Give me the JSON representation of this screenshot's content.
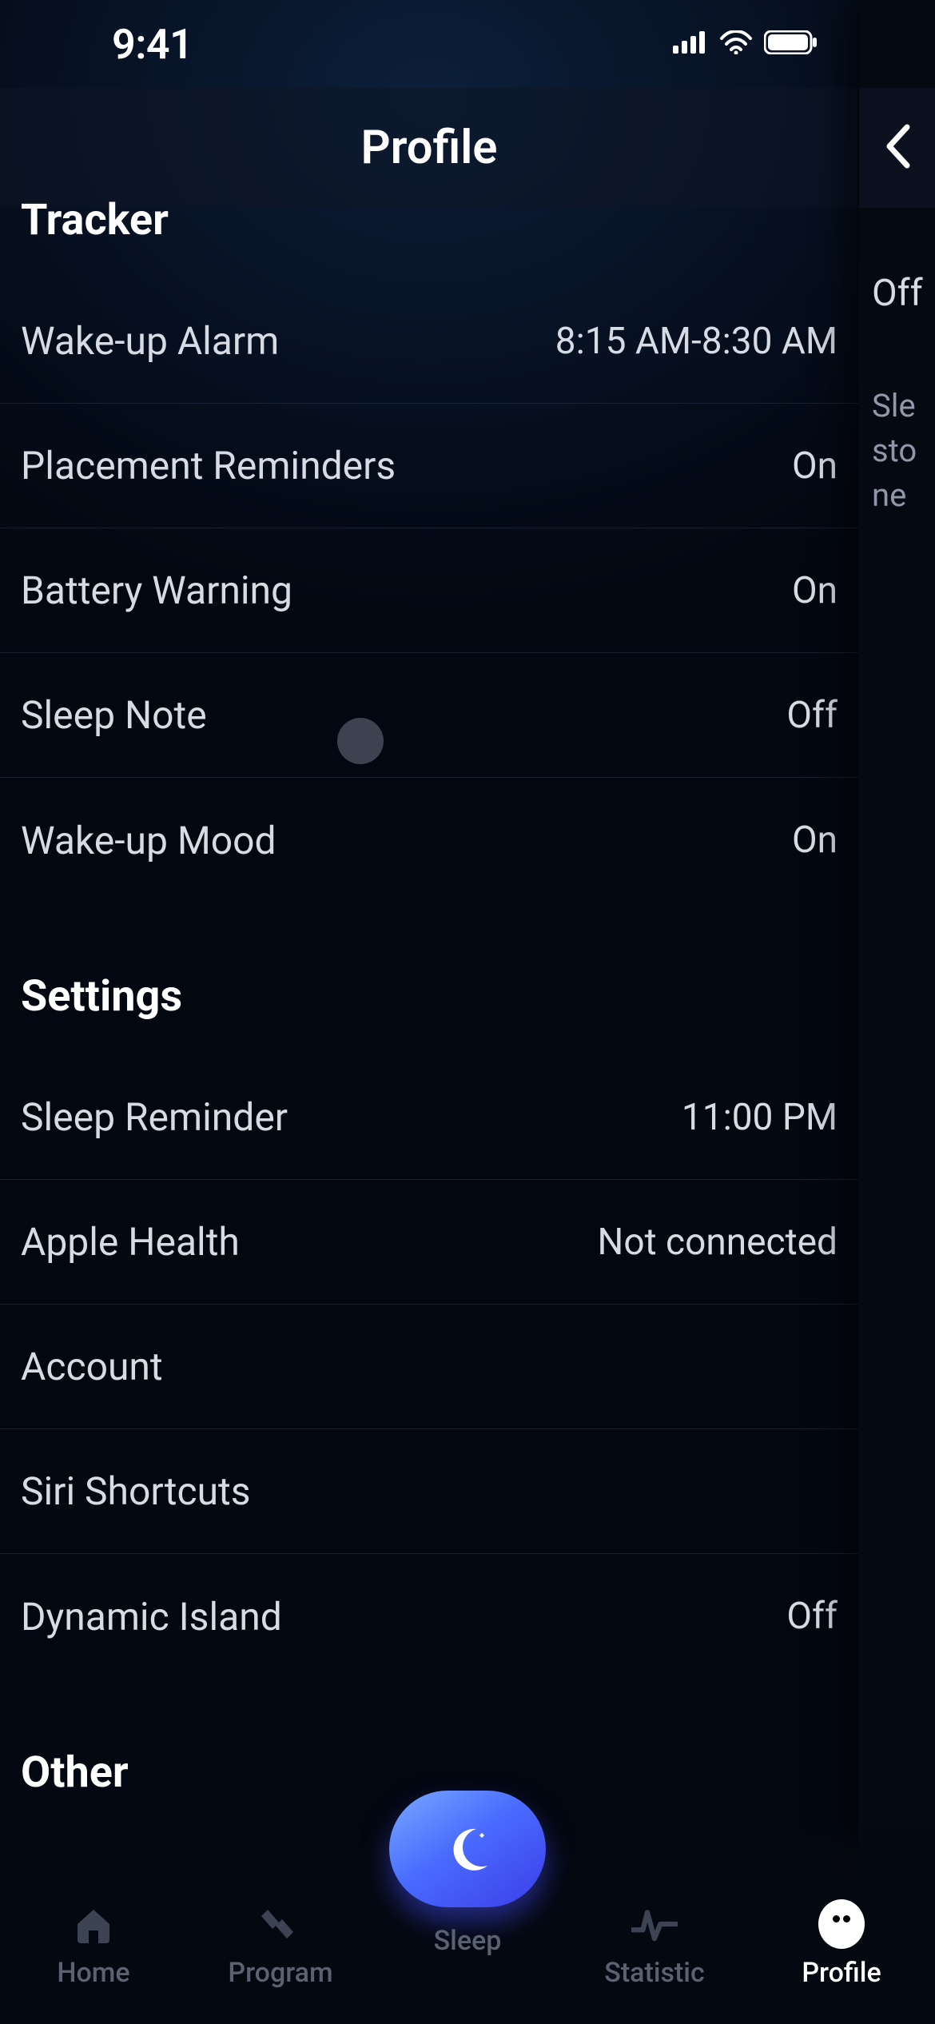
{
  "status": {
    "time": "9:41"
  },
  "header": {
    "title": "Profile"
  },
  "tracker": {
    "title": "Tracker",
    "rows": [
      {
        "label": "Wake-up Alarm",
        "value": "8:15 AM-8:30 AM"
      },
      {
        "label": "Placement Reminders",
        "value": "On"
      },
      {
        "label": "Battery Warning",
        "value": "On"
      },
      {
        "label": "Sleep Note",
        "value": "Off"
      },
      {
        "label": "Wake-up Mood",
        "value": "On"
      }
    ]
  },
  "settings": {
    "title": "Settings",
    "rows": [
      {
        "label": "Sleep Reminder",
        "value": "11:00 PM"
      },
      {
        "label": "Apple Health",
        "value": "Not connected"
      },
      {
        "label": "Account",
        "value": ""
      },
      {
        "label": "Siri Shortcuts",
        "value": ""
      },
      {
        "label": "Dynamic Island",
        "value": "Off"
      }
    ]
  },
  "other": {
    "title": "Other"
  },
  "right_sheet": {
    "value_peek": "Off",
    "desc_peek": "Sle\nsto\nne"
  },
  "tabs": {
    "items": [
      {
        "label": "Home"
      },
      {
        "label": "Program"
      },
      {
        "label": "Sleep"
      },
      {
        "label": "Statistic"
      },
      {
        "label": "Profile"
      }
    ]
  }
}
